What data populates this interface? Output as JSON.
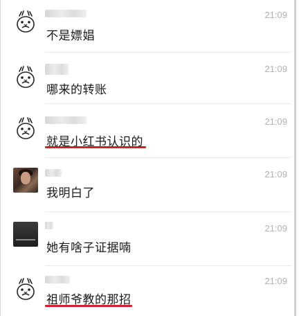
{
  "chat_list": [
    {
      "avatar": "cartoon-face-icon",
      "message": "不是嫖娼",
      "time": "21:09",
      "underlined": false
    },
    {
      "avatar": "cartoon-face-icon",
      "message": "哪来的转账",
      "time": "21:09",
      "underlined": false
    },
    {
      "avatar": "cartoon-face-icon",
      "message": "就是小红书认识的",
      "time": "21:09",
      "underlined": true
    },
    {
      "avatar": "photo-avatar",
      "message": "我明白了",
      "time": "21:09",
      "underlined": false
    },
    {
      "avatar": "photo-avatar-dark",
      "message": "她有啥子证据喃",
      "time": "21:09",
      "underlined": false
    },
    {
      "avatar": "cartoon-face-icon",
      "message": "祖师爷教的那招",
      "time": "21:09",
      "underlined": true
    }
  ],
  "colors": {
    "underline": "#d01f2e",
    "time": "#b0b0b0",
    "text": "#1a1a1a"
  }
}
